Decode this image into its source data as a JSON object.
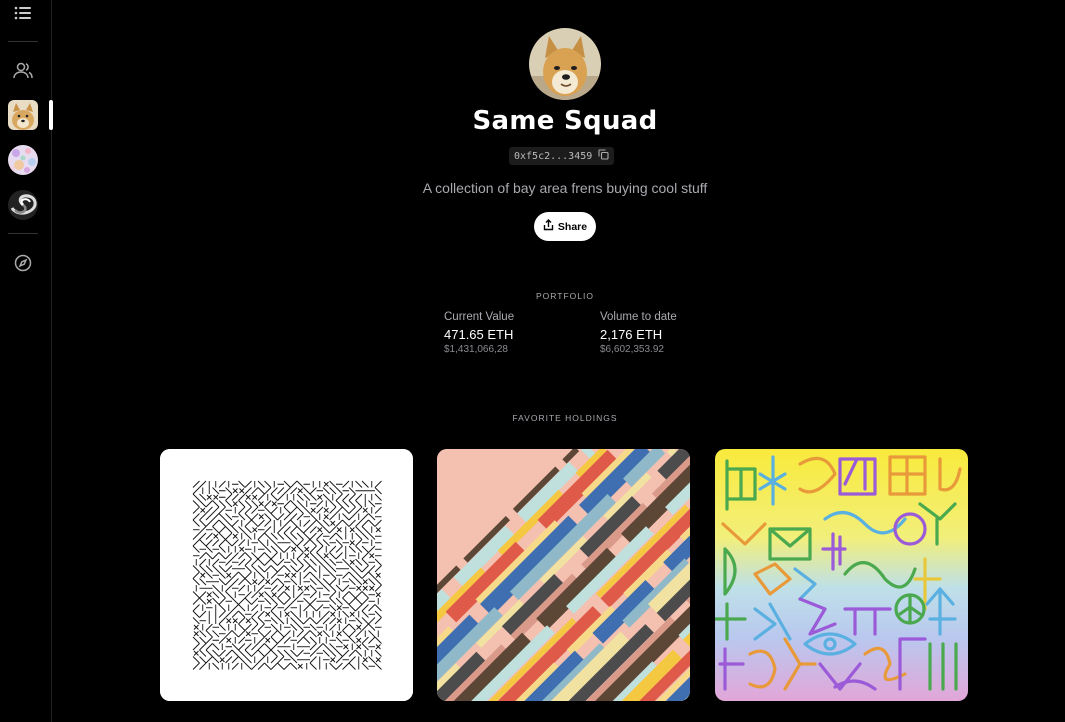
{
  "sidebar": {
    "menu_icon": "list-icon",
    "friends_icon": "users-icon",
    "explore_icon": "compass-icon",
    "avatars": [
      "doge-avatar",
      "floral-avatar",
      "swirl-avatar"
    ]
  },
  "profile": {
    "title": "Same Squad",
    "address": "0xf5c2...3459",
    "description": "A collection of bay area frens buying cool stuff",
    "share_label": "Share"
  },
  "portfolio": {
    "section_label": "PORTFOLIO",
    "current_value": {
      "label": "Current Value",
      "value": "471.65 ETH",
      "usd": "$1,431,066,28"
    },
    "volume": {
      "label": "Volume to date",
      "value": "2,176 ETH",
      "usd": "$6,602,353.92"
    }
  },
  "holdings": {
    "section_label": "FAVORITE HOLDINGS",
    "items": [
      "pattern-glyph-art",
      "diagonal-stripes-art",
      "rainbow-glyph-art"
    ]
  },
  "colors": {
    "background": "#000000",
    "muted_text": "#a9a9b0",
    "stripes_bg": "#f4c0b0",
    "rainbow_top": "#f7e84a",
    "rainbow_bottom": "#d9a3e6"
  }
}
